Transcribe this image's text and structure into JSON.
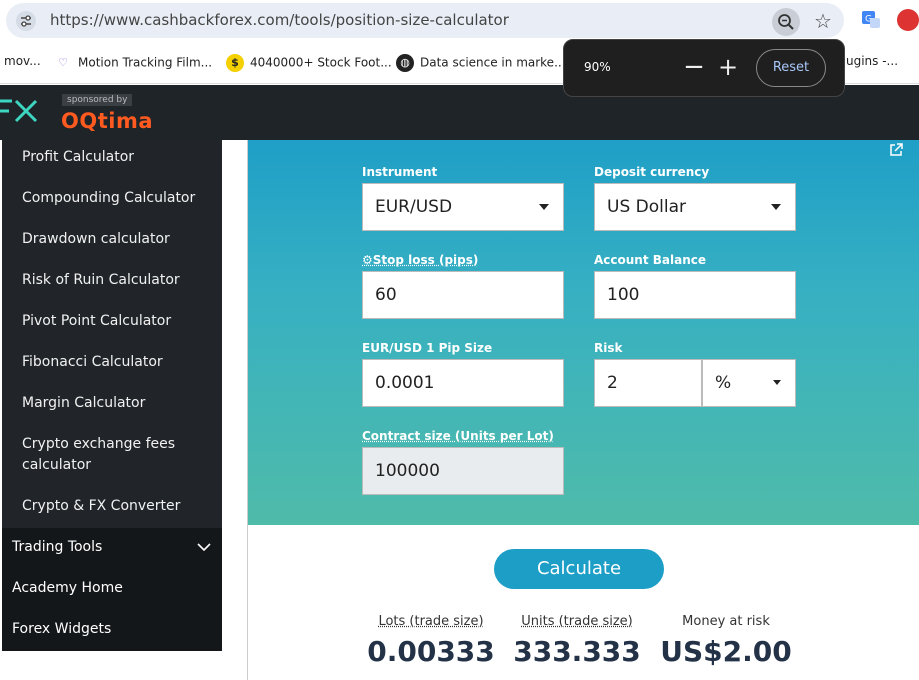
{
  "browser": {
    "url": "https://www.cashbackforex.com/tools/position-size-calculator",
    "bookmarks": [
      "mov...",
      "Motion Tracking Film...",
      "4040000+ Stock Foot...",
      "Data science in marke...",
      "ugins -..."
    ],
    "zoom_popup": {
      "level": "90%",
      "minus": "−",
      "plus": "+",
      "reset": "Reset"
    }
  },
  "header": {
    "logo_text": "FX",
    "sponsored": "sponsored by",
    "sponsor": "OQtima"
  },
  "sidebar": {
    "items": [
      "Profit Calculator",
      "Compounding Calculator",
      "Drawdown calculator",
      "Risk of Ruin Calculator",
      "Pivot Point Calculator",
      "Fibonacci Calculator",
      "Margin Calculator",
      "Crypto exchange fees calculator",
      "Crypto & FX Converter"
    ],
    "lower": [
      "Trading Tools",
      "Academy Home",
      "Forex Widgets"
    ]
  },
  "calculator": {
    "instrument": {
      "label": "Instrument",
      "value": "EUR/USD"
    },
    "deposit_currency": {
      "label": "Deposit currency",
      "value": "US Dollar"
    },
    "stop_loss": {
      "label": "⚙Stop loss (pips)",
      "value": "60"
    },
    "account_balance": {
      "label": "Account Balance",
      "value": "100"
    },
    "pip_size": {
      "label": "EUR/USD 1 Pip Size",
      "value": "0.0001"
    },
    "risk": {
      "label": "Risk",
      "value": "2",
      "unit": "%"
    },
    "contract_size": {
      "label": "Contract size (Units per Lot)",
      "value": "100000"
    },
    "calculate_label": "Calculate"
  },
  "results": {
    "lots": {
      "label": "Lots (trade size)",
      "value": "0.00333"
    },
    "units": {
      "label": "Units (trade size)",
      "value": "333.333"
    },
    "money": {
      "label": "Money at risk",
      "value": "US$2.00"
    }
  },
  "colors": {
    "sponsor": "#ff5a1f",
    "accent": "#1d9ec6",
    "logo": "#3dd6c0"
  }
}
